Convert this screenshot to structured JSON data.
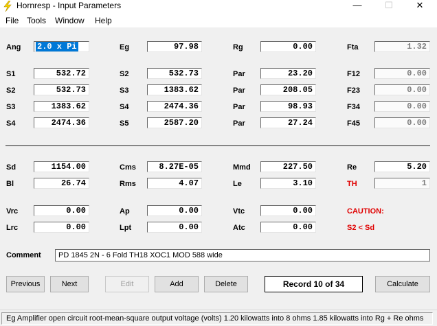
{
  "window": {
    "title": "Hornresp - Input Parameters",
    "min_glyph": "—",
    "max_glyph": "☐",
    "close_glyph": "✕"
  },
  "menu": [
    "File",
    "Tools",
    "Window",
    "Help"
  ],
  "params": {
    "ang": {
      "label": "Ang",
      "value": "2.0 x Pi"
    },
    "eg": {
      "label": "Eg",
      "value": "97.98"
    },
    "rg": {
      "label": "Rg",
      "value": "0.00"
    },
    "fta": {
      "label": "Fta",
      "value": "1.32"
    },
    "s1": {
      "label": "S1",
      "value": "532.72"
    },
    "s2": {
      "label": "S2",
      "value": "532.73"
    },
    "s3": {
      "label": "S3",
      "value": "1383.62"
    },
    "s4": {
      "label": "S4",
      "value": "2474.36"
    },
    "c2_s2": {
      "label": "S2",
      "value": "532.73"
    },
    "c2_s3": {
      "label": "S3",
      "value": "1383.62"
    },
    "c2_s4": {
      "label": "S4",
      "value": "2474.36"
    },
    "c2_s5": {
      "label": "S5",
      "value": "2587.20"
    },
    "par1": {
      "label": "Par",
      "value": "23.20"
    },
    "par2": {
      "label": "Par",
      "value": "208.05"
    },
    "par3": {
      "label": "Par",
      "value": "98.93"
    },
    "par4": {
      "label": "Par",
      "value": "27.24"
    },
    "f12": {
      "label": "F12",
      "value": "0.00"
    },
    "f23": {
      "label": "F23",
      "value": "0.00"
    },
    "f34": {
      "label": "F34",
      "value": "0.00"
    },
    "f45": {
      "label": "F45",
      "value": "0.00"
    },
    "sd": {
      "label": "Sd",
      "value": "1154.00"
    },
    "bl": {
      "label": "Bl",
      "value": "26.74"
    },
    "cms": {
      "label": "Cms",
      "value": "8.27E-05"
    },
    "rms": {
      "label": "Rms",
      "value": "4.07"
    },
    "mmd": {
      "label": "Mmd",
      "value": "227.50"
    },
    "le": {
      "label": "Le",
      "value": "3.10"
    },
    "re": {
      "label": "Re",
      "value": "5.20"
    },
    "th": {
      "label": "TH",
      "value": "1"
    },
    "vrc": {
      "label": "Vrc",
      "value": "0.00"
    },
    "lrc": {
      "label": "Lrc",
      "value": "0.00"
    },
    "ap": {
      "label": "Ap",
      "value": "0.00"
    },
    "lpt": {
      "label": "Lpt",
      "value": "0.00"
    },
    "vtc": {
      "label": "Vtc",
      "value": "0.00"
    },
    "atc": {
      "label": "Atc",
      "value": "0.00"
    }
  },
  "caution": {
    "title": "CAUTION:",
    "message": "S2 < Sd"
  },
  "comment": {
    "label": "Comment",
    "value": "PD 1845 2N - 6 Fold TH18 XOC1 MOD 588 wide"
  },
  "buttons": {
    "previous": "Previous",
    "next": "Next",
    "edit": "Edit",
    "add": "Add",
    "delete": "Delete",
    "calculate": "Calculate"
  },
  "record": "Record 10 of 34",
  "status": "Eg   Amplifier open circuit root-mean-square output voltage  (volts)   1.20 kilowatts into 8 ohms   1.85 kilowatts into Rg + Re ohms",
  "colors": {
    "caution": "#e00000",
    "selection": "#0078d7",
    "client_bg": "#f0f0f0"
  }
}
